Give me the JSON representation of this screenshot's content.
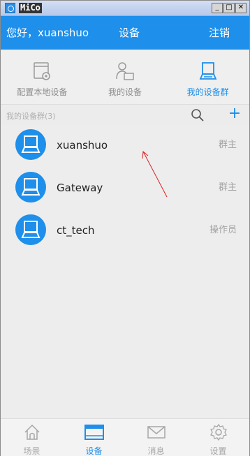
{
  "window": {
    "title": "MiCo",
    "controls": [
      "_",
      "□",
      "✕"
    ]
  },
  "header": {
    "greeting": "您好，xuanshuo",
    "title": "设备",
    "logout": "注销",
    "bg_color": "#1e8fea"
  },
  "top_tabs": [
    {
      "label": "配置本地设备",
      "icon": "device-config-icon",
      "active": false
    },
    {
      "label": "我的设备",
      "icon": "person-device-icon",
      "active": false
    },
    {
      "label": "我的设备群",
      "icon": "device-group-icon",
      "active": true
    }
  ],
  "section": {
    "label": "我的设备群(3)",
    "search_icon": "search-icon",
    "add_label": "+"
  },
  "groups": [
    {
      "name": "xuanshuo",
      "role": "群主"
    },
    {
      "name": "Gateway",
      "role": "群主"
    },
    {
      "name": "ct_tech",
      "role": "操作员"
    }
  ],
  "bottom_nav": [
    {
      "label": "场景",
      "icon": "home-icon",
      "active": false
    },
    {
      "label": "设备",
      "icon": "device-icon",
      "active": true
    },
    {
      "label": "消息",
      "icon": "mail-icon",
      "active": false
    },
    {
      "label": "设置",
      "icon": "gear-icon",
      "active": false
    }
  ],
  "accent_color": "#1e8fea",
  "annotation_color": "#e02020"
}
